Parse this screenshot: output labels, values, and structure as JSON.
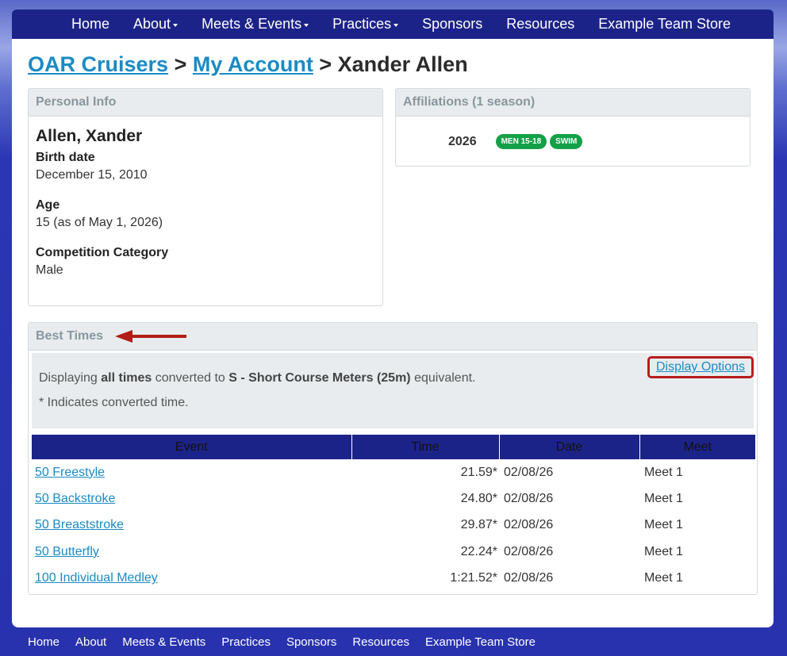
{
  "nav": {
    "items": [
      {
        "label": "Home",
        "dropdown": false
      },
      {
        "label": "About",
        "dropdown": true
      },
      {
        "label": "Meets & Events",
        "dropdown": true
      },
      {
        "label": "Practices",
        "dropdown": true
      },
      {
        "label": "Sponsors",
        "dropdown": false
      },
      {
        "label": "Resources",
        "dropdown": false
      },
      {
        "label": "Example Team Store",
        "dropdown": false
      }
    ]
  },
  "breadcrumb": {
    "team": "OAR Cruisers",
    "sep1": " > ",
    "account": "My Account",
    "sep2": " > ",
    "current": "Xander Allen"
  },
  "personal_info": {
    "heading": "Personal Info",
    "name": "Allen, Xander",
    "birth_label": "Birth date",
    "birth_value": "December 15, 2010",
    "age_label": "Age",
    "age_value": "15 (as of May 1, 2026)",
    "category_label": "Competition Category",
    "category_value": "Male"
  },
  "affiliations": {
    "heading": "Affiliations (1 season)",
    "year": "2026",
    "badges": [
      "MEN 15-18",
      "SWIM"
    ]
  },
  "best_times": {
    "heading": "Best Times",
    "info_prefix": "Displaying ",
    "info_bold1": "all times",
    "info_mid": " converted to ",
    "info_bold2": "S - Short Course Meters (25m)",
    "info_suffix": " equivalent.",
    "note": "* Indicates converted time.",
    "display_options": "Display Options",
    "columns": [
      "Event",
      "Time",
      "Date",
      "Meet"
    ],
    "rows": [
      {
        "event": "50 Freestyle",
        "time": "21.59*",
        "date": "02/08/26",
        "meet": "Meet 1"
      },
      {
        "event": "50 Backstroke",
        "time": "24.80*",
        "date": "02/08/26",
        "meet": "Meet 1"
      },
      {
        "event": "50 Breaststroke",
        "time": "29.87*",
        "date": "02/08/26",
        "meet": "Meet 1"
      },
      {
        "event": "50 Butterfly",
        "time": "22.24*",
        "date": "02/08/26",
        "meet": "Meet 1"
      },
      {
        "event": "100 Individual Medley",
        "time": "1:21.52*",
        "date": "02/08/26",
        "meet": "Meet 1"
      }
    ]
  },
  "footer": {
    "items": [
      "Home",
      "About",
      "Meets & Events",
      "Practices",
      "Sponsors",
      "Resources",
      "Example Team Store"
    ]
  },
  "colors": {
    "nav_bg": "#1c2388",
    "link": "#1a8bc4",
    "badge": "#14a048",
    "highlight": "#b81c1c"
  }
}
